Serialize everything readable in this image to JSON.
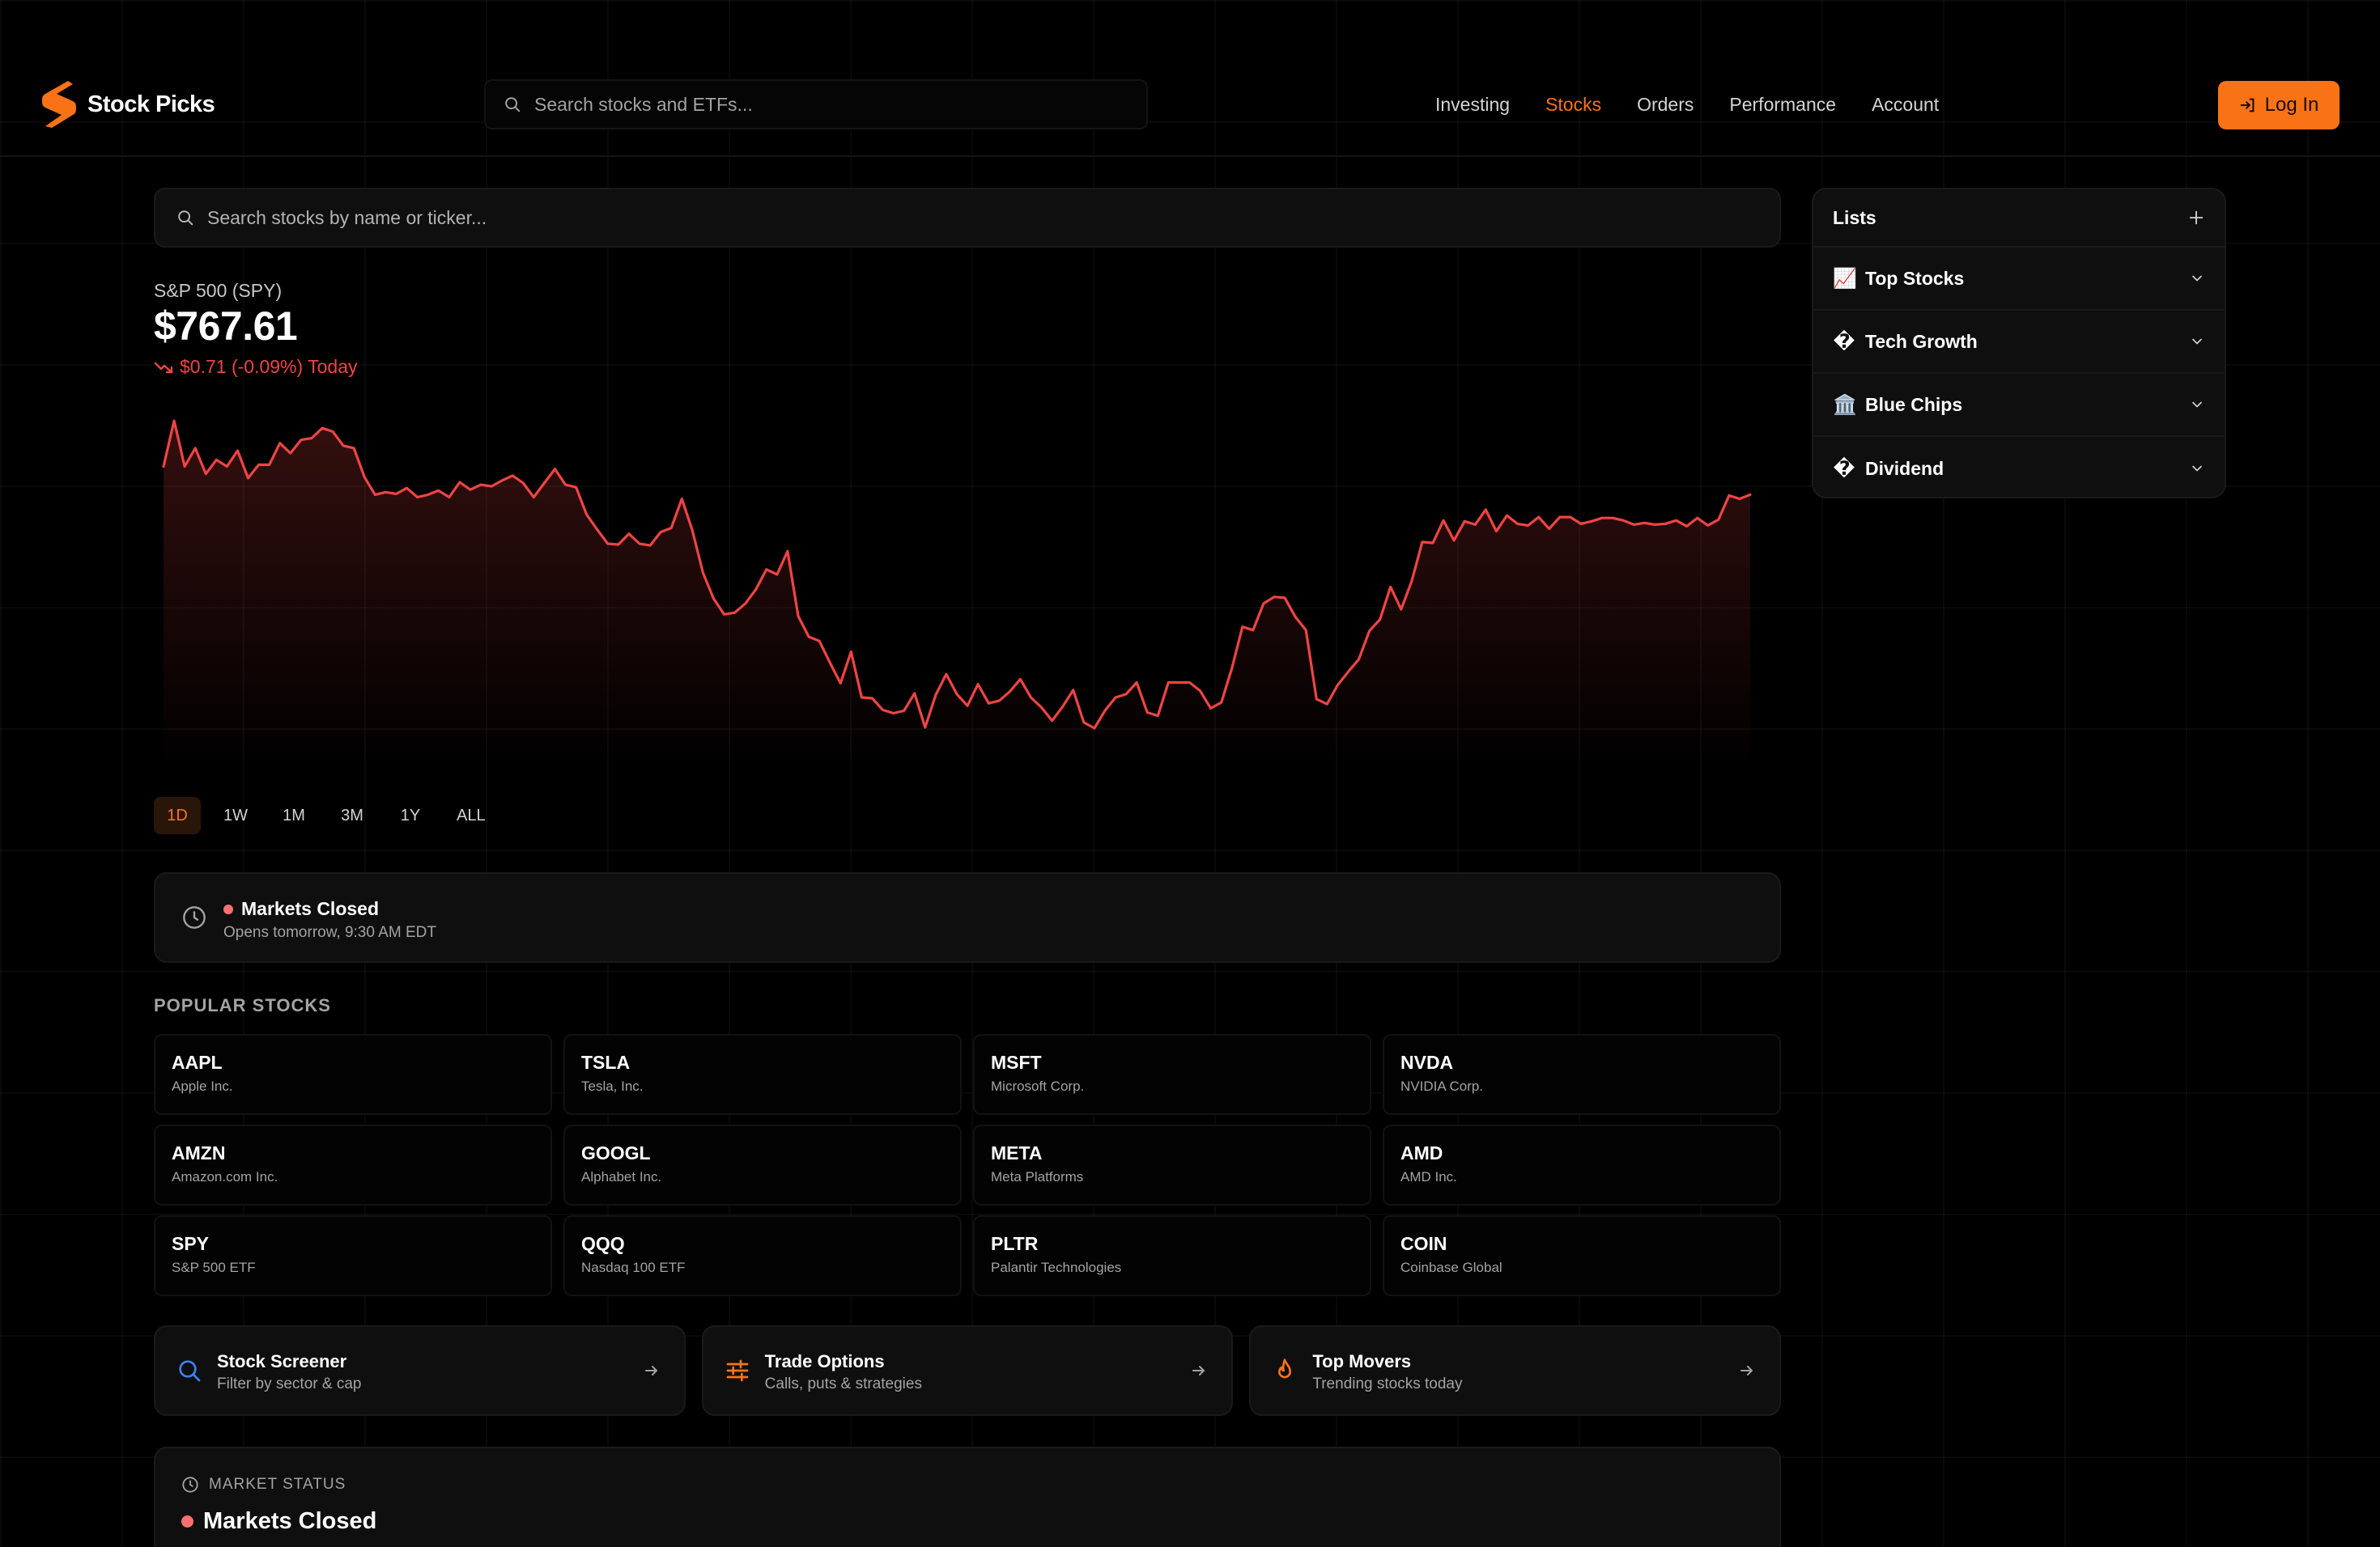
{
  "app": {
    "name": "Stock Picks"
  },
  "colors": {
    "accent": "#f97316",
    "negative": "#ef4444",
    "background": "#000000"
  },
  "header": {
    "search_placeholder": "Search stocks and ETFs...",
    "nav": [
      {
        "label": "Investing",
        "active": false
      },
      {
        "label": "Stocks",
        "active": true
      },
      {
        "label": "Orders",
        "active": false
      },
      {
        "label": "Performance",
        "active": false
      },
      {
        "label": "Account",
        "active": false
      }
    ],
    "login_label": "Log In"
  },
  "main": {
    "search_placeholder": "Search stocks by name or ticker...",
    "index": {
      "name": "S&P 500 (SPY)",
      "price": "$767.61",
      "change": "$0.71 (-0.09%) Today"
    },
    "ranges": [
      {
        "label": "1D",
        "active": true
      },
      {
        "label": "1W",
        "active": false
      },
      {
        "label": "1M",
        "active": false
      },
      {
        "label": "3M",
        "active": false
      },
      {
        "label": "1Y",
        "active": false
      },
      {
        "label": "ALL",
        "active": false
      }
    ],
    "market_card": {
      "title": "Markets Closed",
      "subtitle": "Opens tomorrow, 9:30 AM EDT"
    },
    "popular_title": "POPULAR STOCKS",
    "stocks": [
      {
        "ticker": "AAPL",
        "name": "Apple Inc."
      },
      {
        "ticker": "TSLA",
        "name": "Tesla, Inc."
      },
      {
        "ticker": "MSFT",
        "name": "Microsoft Corp."
      },
      {
        "ticker": "NVDA",
        "name": "NVIDIA Corp."
      },
      {
        "ticker": "AMZN",
        "name": "Amazon.com Inc."
      },
      {
        "ticker": "GOOGL",
        "name": "Alphabet Inc."
      },
      {
        "ticker": "META",
        "name": "Meta Platforms"
      },
      {
        "ticker": "AMD",
        "name": "AMD Inc."
      },
      {
        "ticker": "SPY",
        "name": "S&P 500 ETF"
      },
      {
        "ticker": "QQQ",
        "name": "Nasdaq 100 ETF"
      },
      {
        "ticker": "PLTR",
        "name": "Palantir Technologies"
      },
      {
        "ticker": "COIN",
        "name": "Coinbase Global"
      }
    ],
    "actions": [
      {
        "title": "Stock Screener",
        "subtitle": "Filter by sector & cap",
        "icon": "search-icon"
      },
      {
        "title": "Trade Options",
        "subtitle": "Calls, puts & strategies",
        "icon": "sliders-icon"
      },
      {
        "title": "Top Movers",
        "subtitle": "Trending stocks today",
        "icon": "flame-icon"
      }
    ],
    "status_card": {
      "label": "MARKET STATUS",
      "value": "Markets Closed"
    }
  },
  "sidebar": {
    "title": "Lists",
    "items": [
      {
        "emoji": "📈",
        "label": "Top Stocks"
      },
      {
        "emoji": "�",
        "label": "Tech Growth"
      },
      {
        "emoji": "🏛️",
        "label": "Blue Chips"
      },
      {
        "emoji": "�",
        "label": "Dividend"
      }
    ]
  },
  "chart_data": {
    "type": "line",
    "series": [
      {
        "values": [
          767.95,
          768.5,
          767.95,
          768.17,
          767.86,
          768.03,
          767.95,
          768.14,
          767.81,
          767.97,
          767.97,
          768.23,
          768.11,
          768.27,
          768.29,
          768.41,
          768.37,
          768.2,
          768.17,
          767.82,
          767.61,
          767.64,
          767.62,
          767.69,
          767.58,
          767.61,
          767.66,
          767.58,
          767.76,
          767.67,
          767.73,
          767.71,
          767.78,
          767.84,
          767.75,
          767.58,
          767.75,
          767.92,
          767.73,
          767.7,
          767.37,
          767.19,
          767.02,
          767.01,
          767.14,
          767.02,
          767.0,
          767.16,
          767.21,
          767.56,
          767.18,
          766.67,
          766.36,
          766.17,
          766.19,
          766.3,
          766.47,
          766.71,
          766.65,
          766.93,
          766.15,
          765.9,
          765.85,
          765.59,
          765.34,
          765.72,
          765.17,
          765.16,
          765.02,
          764.98,
          765.01,
          765.22,
          764.81,
          765.2,
          765.45,
          765.21,
          765.07,
          765.33,
          765.1,
          765.13,
          765.24,
          765.39,
          765.17,
          765.05,
          764.89,
          765.06,
          765.26,
          764.87,
          764.8,
          765.01,
          765.17,
          765.21,
          765.35,
          764.99,
          764.95,
          765.35,
          765.35,
          765.35,
          765.25,
          765.04,
          765.11,
          765.52,
          766.02,
          765.98,
          766.3,
          766.38,
          766.37,
          766.14,
          765.98,
          765.15,
          765.09,
          765.32,
          765.48,
          765.63,
          765.97,
          766.11,
          766.5,
          766.23,
          766.57,
          767.04,
          767.03,
          767.3,
          767.06,
          767.29,
          767.25,
          767.43,
          767.17,
          767.36,
          767.26,
          767.24,
          767.34,
          767.2,
          767.34,
          767.34,
          767.26,
          767.29,
          767.33,
          767.33,
          767.3,
          767.25,
          767.27,
          767.25,
          767.26,
          767.3,
          767.23,
          767.33,
          767.24,
          767.31,
          767.6,
          767.56,
          767.61
        ]
      }
    ]
  }
}
